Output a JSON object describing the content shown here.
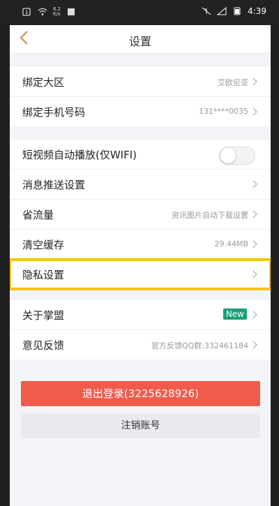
{
  "status_bar": {
    "network_speed": "6.2\nK/s",
    "time": "4:39"
  },
  "header": {
    "title": "设置"
  },
  "section1": [
    {
      "label": "绑定大区",
      "value": "艾欧尼亚"
    },
    {
      "label": "绑定手机号码",
      "value": "131****0035"
    }
  ],
  "section2": [
    {
      "label": "短视频自动播放(仅WIFI)",
      "toggle": false
    },
    {
      "label": "消息推送设置",
      "value": ""
    },
    {
      "label": "省流量",
      "value": "资讯图片自动下载设置"
    },
    {
      "label": "清空缓存",
      "value": "29.44MB"
    },
    {
      "label": "隐私设置",
      "value": ""
    }
  ],
  "section3": [
    {
      "label": "关于掌盟",
      "badge": "New"
    },
    {
      "label": "意见反馈",
      "value": "官方反馈QQ群:332461184"
    }
  ],
  "buttons": {
    "logout": "退出登录(3225628926)",
    "cancel_account": "注销账号"
  },
  "colors": {
    "accent_gold": "#c9a063",
    "logout_red": "#f15b4b",
    "new_badge": "#1aa079",
    "highlight": "#f5c21b"
  }
}
